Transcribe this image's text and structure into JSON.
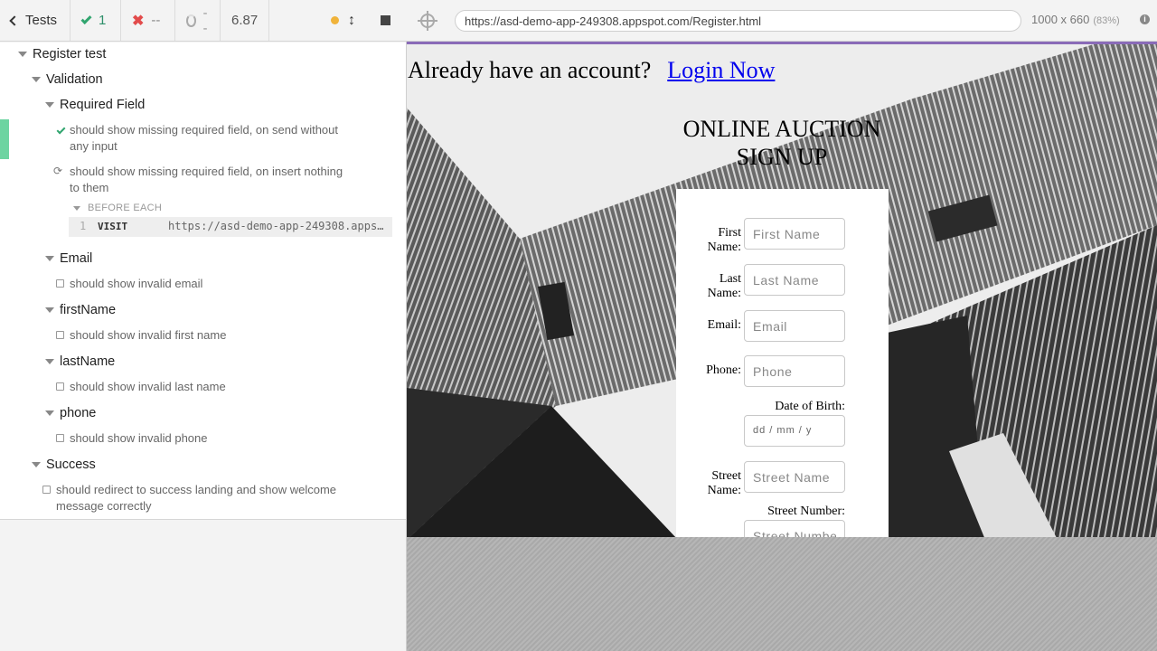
{
  "reporter": {
    "header": {
      "tests_label": "Tests",
      "passed_count": "1",
      "failed_count": "--",
      "pending_count": "--",
      "duration": "6.87"
    },
    "tree": {
      "root_suite": "Register test",
      "validation_suite": "Validation",
      "required_field_suite": "Required Field",
      "test_required_1_line1": "should show missing required field, on send without",
      "test_required_1_line2": "any input",
      "test_required_2_line1": "should show missing required field, on insert nothing",
      "test_required_2_line2": "to them",
      "before_each_label": "BEFORE EACH",
      "command": {
        "number": "1",
        "name": "VISIT",
        "message": "https://asd-demo-app-249308.appspot.com/Register.html"
      },
      "email_suite": "Email",
      "email_test": "should show invalid email",
      "firstname_suite": "firstName",
      "firstname_test": "should show invalid first name",
      "lastname_suite": "lastName",
      "lastname_test": "should show invalid last name",
      "phone_suite": "phone",
      "phone_test": "should show invalid phone",
      "success_suite": "Success",
      "success_test_line1": "should redirect to success landing and show welcome",
      "success_test_line2": "message correctly"
    }
  },
  "aut": {
    "url": "https://asd-demo-app-249308.appspot.com/Register.html",
    "viewport_size": "1000 x 660",
    "viewport_scale": "(83%)",
    "page": {
      "login_prompt": "Already have an account?",
      "login_link": "Login Now",
      "title_line1": "ONLINE AUCTION",
      "title_line2": "SIGN UP",
      "fields": {
        "first_name_label": "First Name:",
        "first_name_placeholder": "First Name",
        "last_name_label": "Last Name:",
        "last_name_placeholder": "Last Name",
        "email_label": "Email:",
        "email_placeholder": "Email",
        "phone_label": "Phone:",
        "phone_placeholder": "Phone",
        "dob_label": "Date of Birth:",
        "dob_value": "dd / mm / y",
        "street_name_label": "Street Name:",
        "street_name_placeholder": "Street Name",
        "street_number_label": "Street Number:",
        "street_number_placeholder": "Street Number"
      }
    }
  },
  "colors": {
    "pass_green": "#31a56f",
    "fail_red": "#e24b4b",
    "running_strip": "#6dd4a1",
    "aut_border_purple": "#8a6bb8",
    "link_blue": "#0000ee"
  }
}
